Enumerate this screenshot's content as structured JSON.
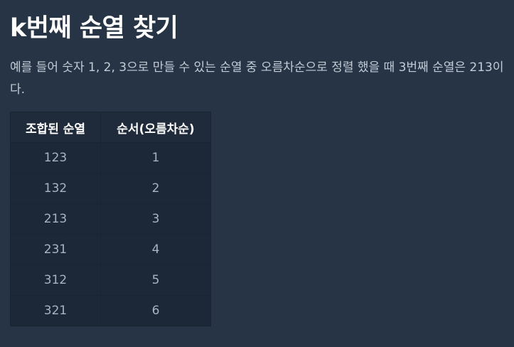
{
  "page": {
    "title": "k번째 순열 찾기",
    "description": "예를 들어 숫자 1, 2, 3으로 만들 수 있는 순열 중 오름차순으로 정렬 했을 때 3번째 순열은 213이다."
  },
  "table": {
    "headers": [
      "조합된 순열",
      "순서(오름차순)"
    ],
    "rows": [
      [
        "123",
        "1"
      ],
      [
        "132",
        "2"
      ],
      [
        "213",
        "3"
      ],
      [
        "231",
        "4"
      ],
      [
        "312",
        "5"
      ],
      [
        "321",
        "6"
      ]
    ]
  },
  "colors": {
    "background": "#263445",
    "table_cell": "#1c2737",
    "heading": "#ffffff",
    "text": "#c3ccd6"
  }
}
